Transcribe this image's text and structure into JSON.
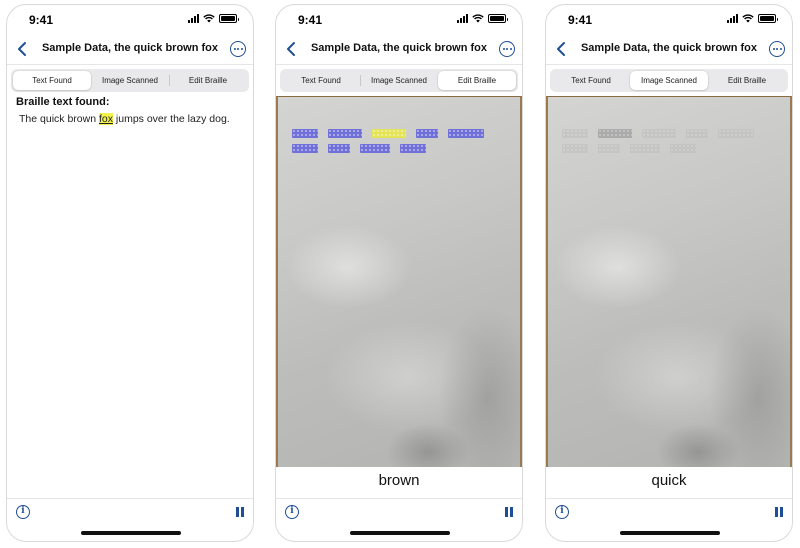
{
  "status": {
    "time": "9:41"
  },
  "nav": {
    "title": "Sample Data, the quick brown fox"
  },
  "tabs": [
    "Text Found",
    "Image Scanned",
    "Edit Braille"
  ],
  "screens": [
    {
      "active_tab": 0,
      "heading": "Braille text found:",
      "sentence_before": "The quick brown ",
      "sentence_highlight": "fox",
      "sentence_after": " jumps over the lazy dog."
    },
    {
      "active_tab": 2,
      "caption": "brown"
    },
    {
      "active_tab": 1,
      "caption": "quick"
    }
  ],
  "colors": {
    "accent": "#1f4e96",
    "braille_overlay": "#6f6fd8",
    "highlight": "#e4e457"
  },
  "icons": {
    "back": "chevron-left-icon",
    "more": "ellipsis-circle-icon",
    "info": "info-circle-icon",
    "pause": "pause-icon"
  }
}
